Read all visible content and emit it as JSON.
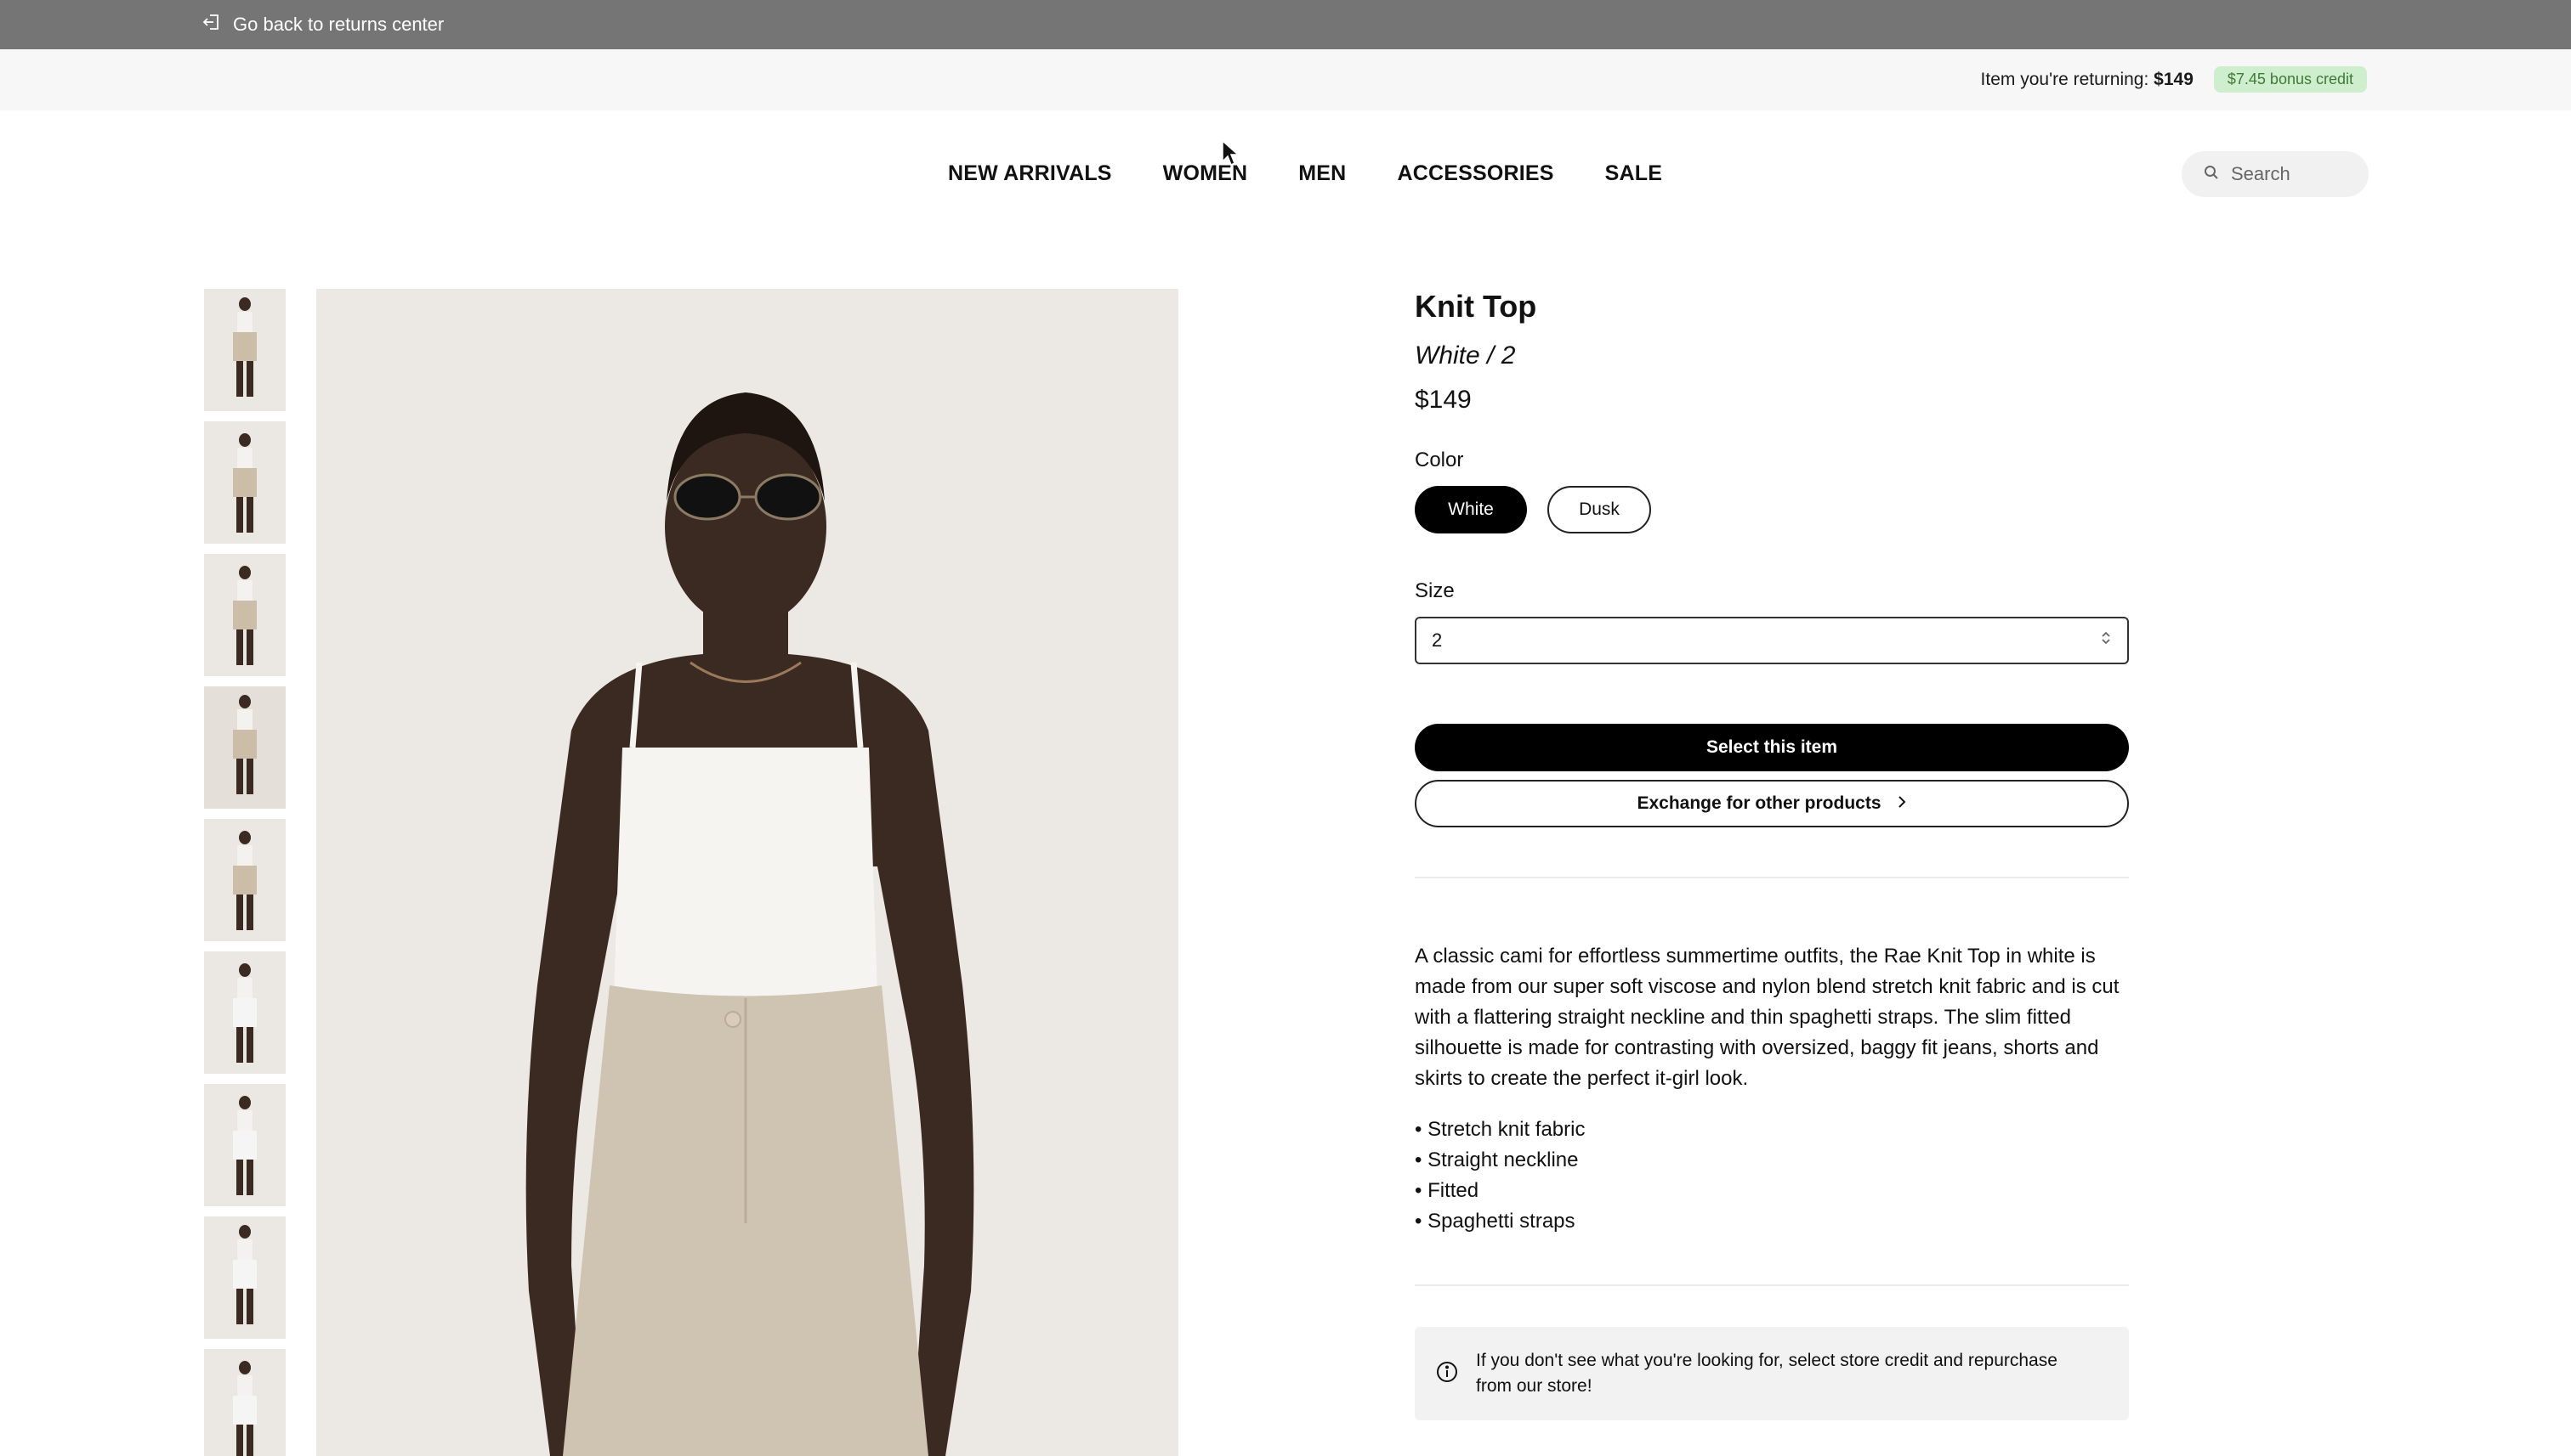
{
  "topbar": {
    "back_label": "Go back to returns center"
  },
  "returning": {
    "label": "Item you're returning:",
    "amount": "$149",
    "bonus": "$7.45 bonus credit"
  },
  "nav": {
    "items": [
      "NEW ARRIVALS",
      "WOMEN",
      "MEN",
      "ACCESSORIES",
      "SALE"
    ],
    "search_placeholder": "Search"
  },
  "product": {
    "title": "Knit Top",
    "variant": "White / 2",
    "price": "$149",
    "color_label": "Color",
    "colors": [
      "White",
      "Dusk"
    ],
    "selected_color": "White",
    "size_label": "Size",
    "size_value": "2",
    "select_button": "Select this item",
    "exchange_button": "Exchange for other products",
    "description": "A classic cami for effortless summertime outfits, the Rae Knit Top in white is made from our super soft viscose and nylon blend stretch knit fabric and is cut with a flattering straight neckline and thin spaghetti straps. The slim fitted silhouette is made for contrasting with oversized, baggy fit jeans, shorts and skirts to create the perfect it-girl look.",
    "bullets": [
      "• Stretch knit fabric",
      "• Straight neckline",
      "• Fitted",
      "• Spaghetti straps"
    ],
    "notice": "If you don't see what you're looking for, select store credit and repurchase from our store!"
  },
  "thumbnails": {
    "count": 9
  },
  "icons": {
    "back": "exit-door-icon",
    "search": "search-icon",
    "select": "chevron-updown-icon",
    "exchange": "chevron-right-icon",
    "notice": "info-icon"
  },
  "colors": {
    "bonus_bg": "#cfeecd",
    "bonus_text": "#3d7a38",
    "topbar": "#757575"
  }
}
